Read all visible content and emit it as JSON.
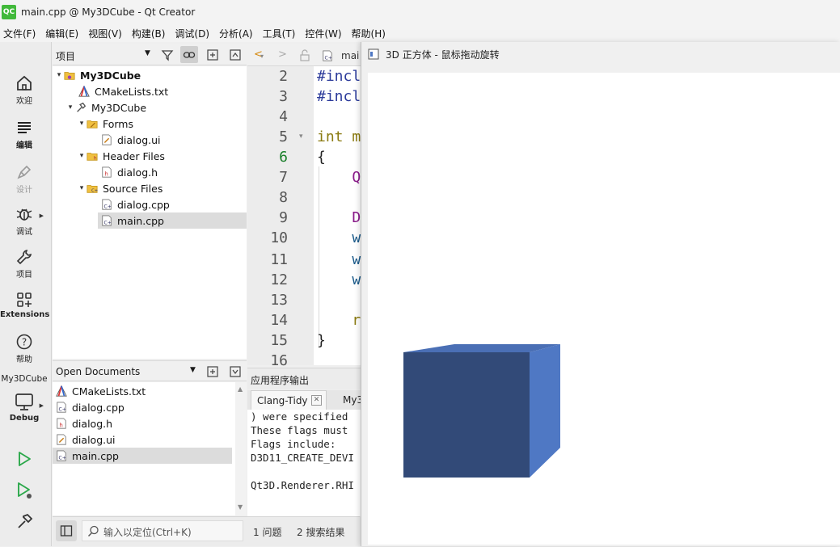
{
  "window": {
    "app_icon": "QC",
    "title": "main.cpp @ My3DCube - Qt Creator"
  },
  "menu": [
    "文件(F)",
    "编辑(E)",
    "视图(V)",
    "构建(B)",
    "调试(D)",
    "分析(A)",
    "工具(T)",
    "控件(W)",
    "帮助(H)"
  ],
  "modes": {
    "welcome": "欢迎",
    "edit": "编辑",
    "design": "设计",
    "debug": "调试",
    "projects": "项目",
    "extensions": "Extensions",
    "help": "帮助",
    "kit_project": "My3DCube",
    "kit_build": "Debug"
  },
  "project_pane": {
    "selector": "项目",
    "tree": {
      "root": "My3DCube",
      "cmake": "CMakeLists.txt",
      "target": "My3DCube",
      "forms": "Forms",
      "dialog_ui": "dialog.ui",
      "headers": "Header Files",
      "dialog_h": "dialog.h",
      "sources": "Source Files",
      "dialog_cpp": "dialog.cpp",
      "main_cpp": "main.cpp"
    }
  },
  "open_documents": {
    "title": "Open Documents",
    "items": [
      "CMakeLists.txt",
      "dialog.cpp",
      "dialog.h",
      "dialog.ui",
      "main.cpp"
    ]
  },
  "editor": {
    "file_tab": "mai",
    "line_numbers": [
      "2",
      "3",
      "4",
      "5",
      "6",
      "7",
      "8",
      "9",
      "10",
      "11",
      "12",
      "13",
      "14",
      "15",
      "16"
    ],
    "lines": [
      "#incl",
      "#incl",
      "",
      "int m",
      "{",
      "    Q",
      "",
      "    D",
      "    w",
      "    w",
      "    w",
      "",
      "    r",
      "}",
      ""
    ]
  },
  "output": {
    "title": "应用程序输出",
    "tabs": [
      "Clang-Tidy",
      "My3"
    ],
    "lines": [
      ") were specified",
      "These flags must",
      "Flags include:",
      "D3D11_CREATE_DEVI",
      "",
      "Qt3D.Renderer.RHI"
    ]
  },
  "bottom_bar": {
    "locator_placeholder": "输入以定位(Ctrl+K)",
    "issues": "1 问题",
    "search": "2 搜索结果"
  },
  "window3d": {
    "title": "3D 正方体 - 鼠标拖动旋转",
    "cube_colors": {
      "front": "#324a78",
      "side": "#4f78c4",
      "top": "#4a6fb5"
    }
  }
}
